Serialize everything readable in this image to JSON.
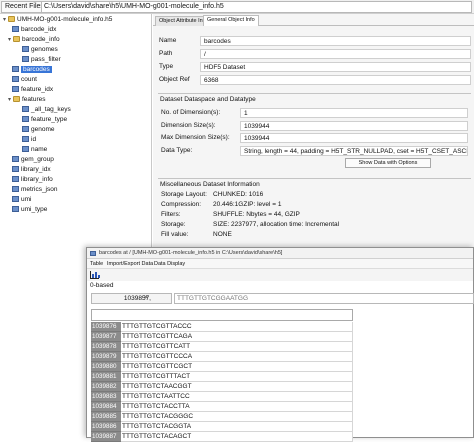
{
  "topbar": {
    "recent_label": "Recent Files",
    "path": "C:\\Users\\david\\share\\h5\\UMH-MO-g001-molecule_info.h5"
  },
  "tree": {
    "root": "UMH-MO-g001-molecule_info.h5",
    "items": [
      {
        "label": "barcode_idx",
        "type": "dataset"
      },
      {
        "label": "barcode_info",
        "type": "group"
      },
      {
        "label": "genomes",
        "type": "dataset"
      },
      {
        "label": "pass_filter",
        "type": "dataset"
      },
      {
        "label": "barcodes",
        "type": "dataset"
      },
      {
        "label": "count",
        "type": "dataset"
      },
      {
        "label": "feature_idx",
        "type": "dataset"
      },
      {
        "label": "features",
        "type": "group"
      },
      {
        "label": "_all_tag_keys",
        "type": "dataset"
      },
      {
        "label": "feature_type",
        "type": "dataset"
      },
      {
        "label": "genome",
        "type": "dataset"
      },
      {
        "label": "id",
        "type": "dataset"
      },
      {
        "label": "name",
        "type": "dataset"
      },
      {
        "label": "gem_group",
        "type": "dataset"
      },
      {
        "label": "library_idx",
        "type": "dataset"
      },
      {
        "label": "library_info",
        "type": "dataset"
      },
      {
        "label": "metrics_json",
        "type": "dataset"
      },
      {
        "label": "umi",
        "type": "dataset"
      },
      {
        "label": "umi_type",
        "type": "dataset"
      }
    ]
  },
  "tabs": [
    "Object Attribute Info",
    "General Object Info"
  ],
  "object": {
    "name_label": "Name",
    "name": "barcodes",
    "path_label": "Path",
    "path": "/",
    "type_label": "Type",
    "type": "HDF5 Dataset",
    "ref_label": "Object Ref",
    "ref": "6368"
  },
  "dataspace": {
    "title": "Dataset Dataspace and Datatype",
    "ndims_label": "No. of Dimension(s):",
    "ndims": "1",
    "dimsize_label": "Dimension Size(s):",
    "dimsize": "1039944",
    "maxdim_label": "Max Dimension Size(s):",
    "maxdim": "1039944",
    "dtype_label": "Data Type:",
    "dtype": "String, length = 44, padding = H5T_STR_NULLPAD, cset = H5T_CSET_ASCII",
    "show_button": "Show Data with Options"
  },
  "misc": {
    "title": "Miscellaneous Dataset Information",
    "layout_label": "Storage Layout:",
    "layout": "CHUNKED: 1016",
    "compression_label": "Compression:",
    "compression": "20.446:1GZIP: level = 1",
    "filters_label": "Filters:",
    "filters": "SHUFFLE: Nbytes = 44, GZIP",
    "storage_label": "Storage:",
    "storage": "SIZE: 2237977, allocation time: Incremental",
    "fill_label": "Fill value:",
    "fill": "NONE"
  },
  "data_window": {
    "title": "barcodes  at  /  [UMH-MO-g001-molecule_info.h5  in  C:\\Users\\david\\share\\h5]",
    "menu": [
      "Table",
      "Import/Export Data",
      "Data Display"
    ],
    "index_base": "0-based",
    "cell_address": "1039857,",
    "cell_eq": "=",
    "cell_value": "TTTGTTGTCGGAATGG",
    "rows": [
      {
        "index": "1039876",
        "value": "TTTGTTGTCGTTACCC"
      },
      {
        "index": "1039877",
        "value": "TTTGTTGTCGTTCAGA"
      },
      {
        "index": "1039878",
        "value": "TTTGTTGTCGTTCATT"
      },
      {
        "index": "1039879",
        "value": "TTTGTTGTCGTTCCCA"
      },
      {
        "index": "1039880",
        "value": "TTTGTTGTCGTTCGCT"
      },
      {
        "index": "1039881",
        "value": "TTTGTTGTCGTTTACT"
      },
      {
        "index": "1039882",
        "value": "TTTGTTGTCTAACGGT"
      },
      {
        "index": "1039883",
        "value": "TTTGTTGTCTAATTCC"
      },
      {
        "index": "1039884",
        "value": "TTTGTTGTCTACCTTA"
      },
      {
        "index": "1039885",
        "value": "TTTGTTGTCTACGGGC"
      },
      {
        "index": "1039886",
        "value": "TTTGTTGTCTACGGTA"
      },
      {
        "index": "1039887",
        "value": "TTTGTTGTCTACAGCT"
      }
    ]
  },
  "colors": {
    "selection": "#3875d7",
    "row_header": "#8c8c8c",
    "folder": "#e8c45a",
    "dataset": "#6b8fc9"
  }
}
